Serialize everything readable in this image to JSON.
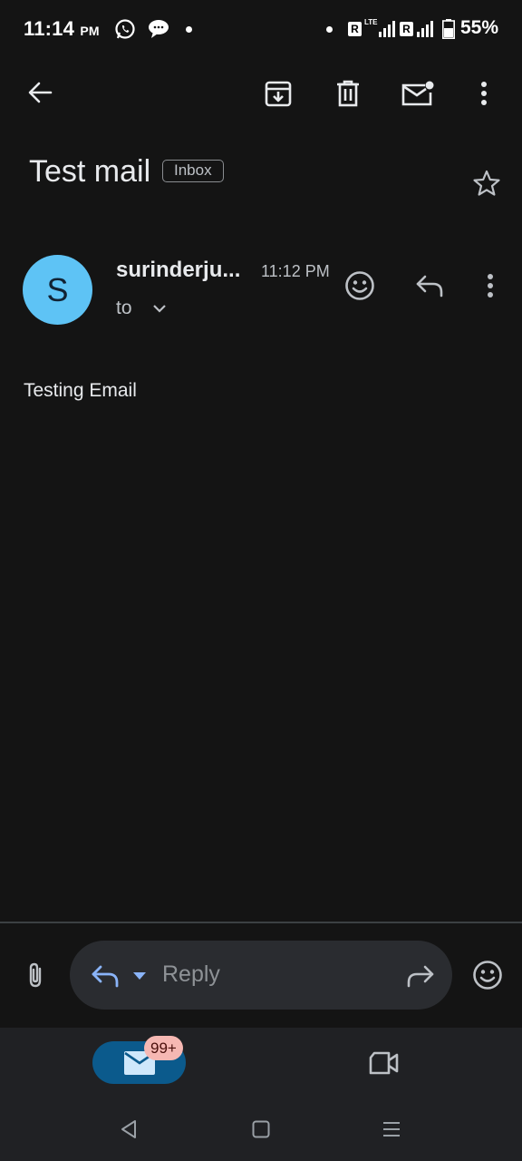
{
  "status_bar": {
    "time": "11:14",
    "ampm": "PM",
    "battery": "55%",
    "roaming_1": "R",
    "network_1": "LTE",
    "roaming_2": "R"
  },
  "toolbar": {
    "back_icon": "arrow-left-icon",
    "archive_icon": "archive-icon",
    "delete_icon": "trash-icon",
    "mark_unread_icon": "mark-unread-icon",
    "more_icon": "more-vert-icon"
  },
  "email": {
    "subject": "Test mail",
    "label": "Inbox",
    "sender_initial": "S",
    "sender": "surinderju...",
    "time": "11:12 PM",
    "to": "to",
    "body": "Testing Email",
    "avatar_color": "#5ec3f5"
  },
  "compose_bar": {
    "reply_placeholder": "Reply"
  },
  "bottom_nav": {
    "mail_badge": "99+",
    "accent": "#0b5a8c"
  },
  "colors": {
    "background": "#141414",
    "text_primary": "#e8eaed",
    "text_secondary": "#bdc1c6",
    "reply_icon": "#8ab4f8"
  }
}
